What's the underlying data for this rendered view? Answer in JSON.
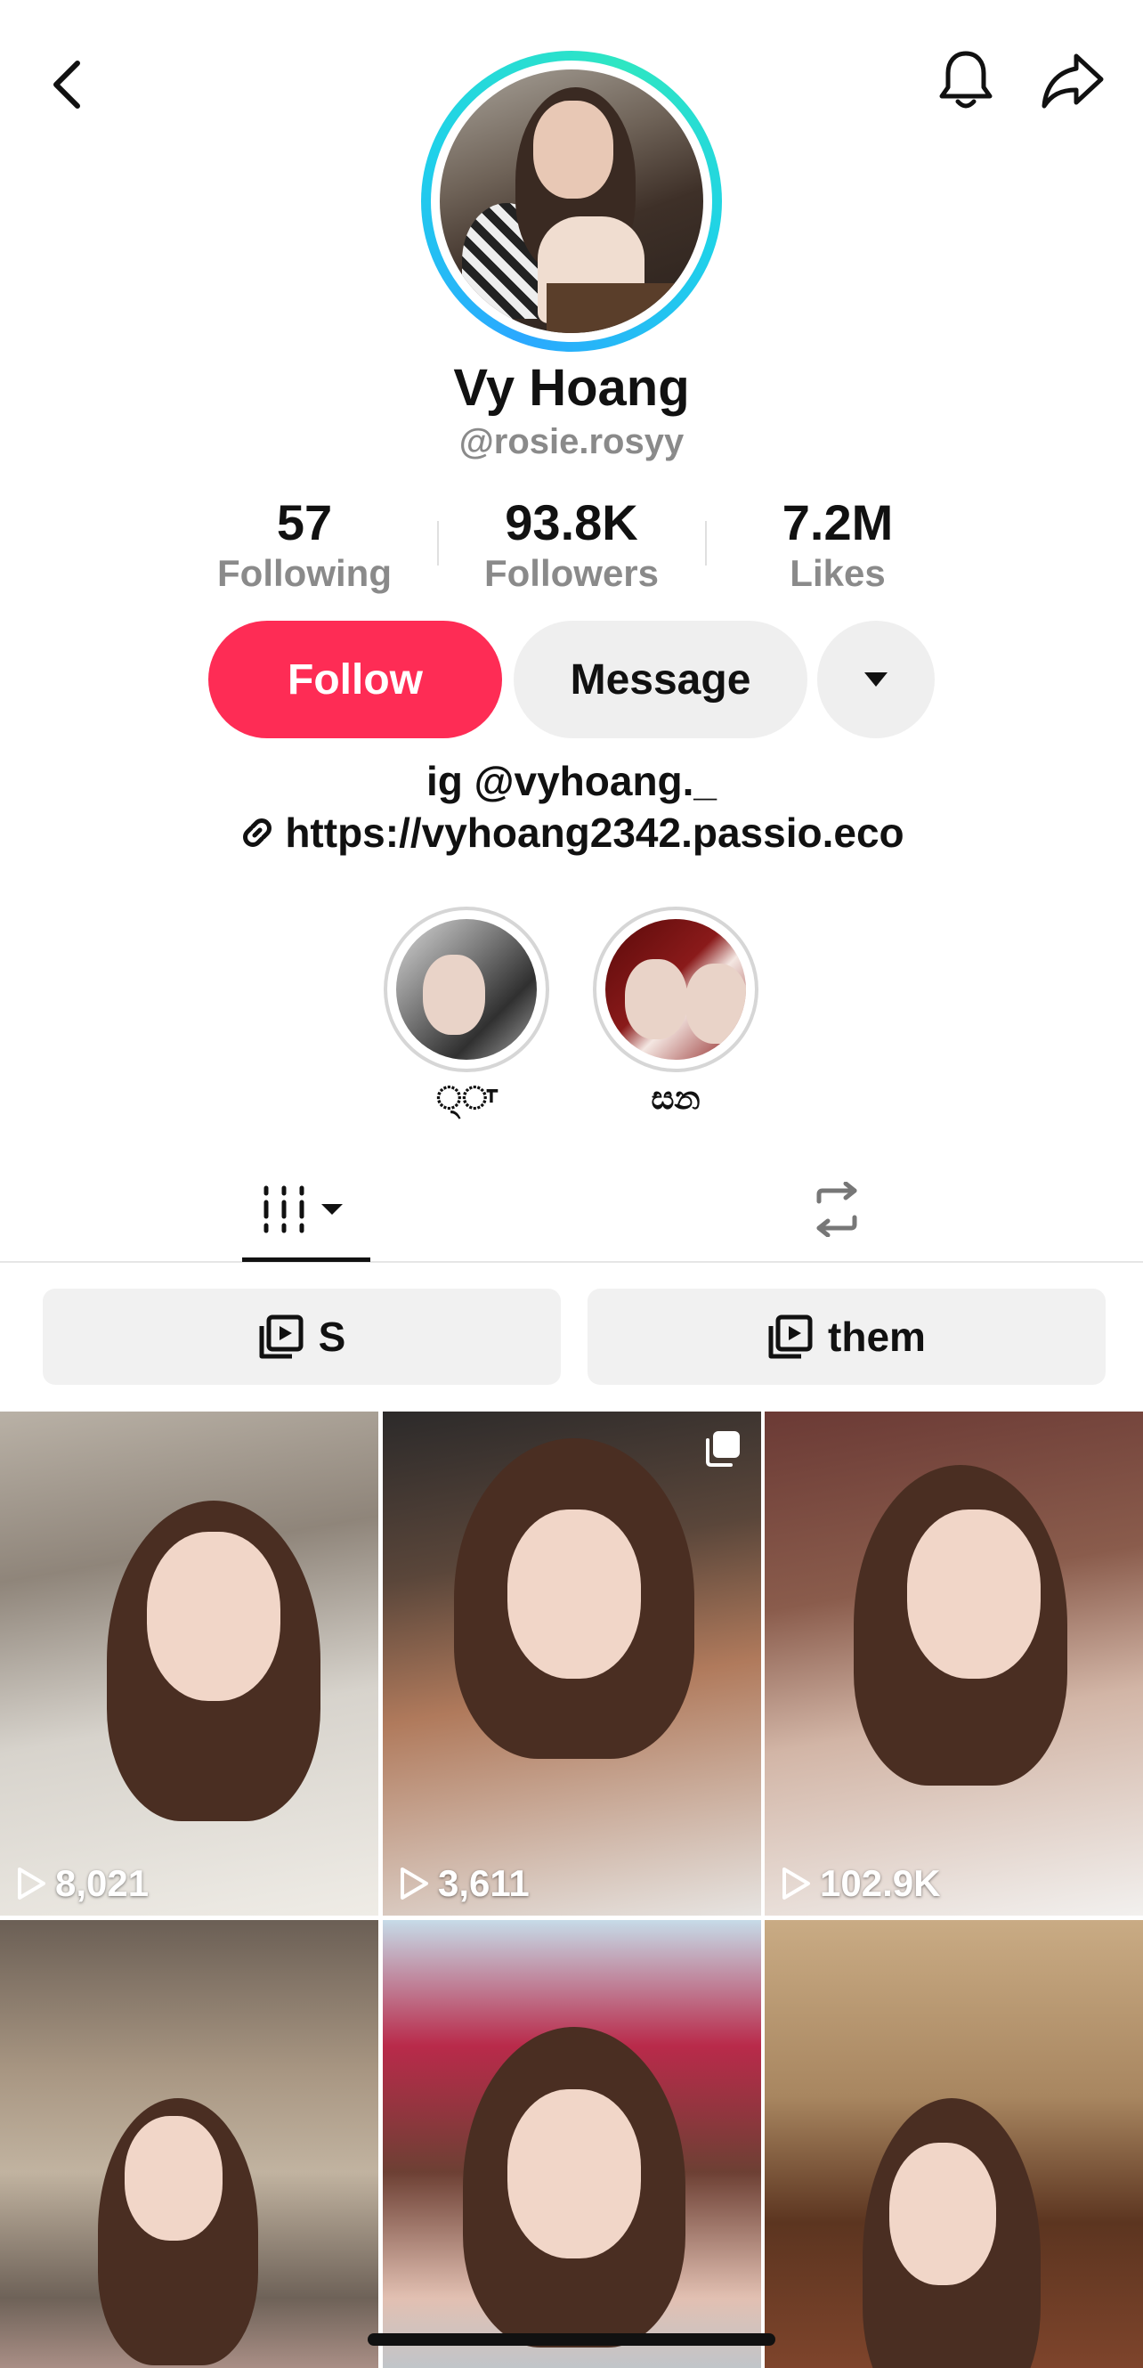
{
  "profile": {
    "name": "Vy Hoang",
    "handle": "@rosie.rosyy",
    "bio": "ig @vyhoang._",
    "link": "https://vyhoang2342.passio.eco"
  },
  "stats": [
    {
      "value": "57",
      "label": "Following"
    },
    {
      "value": "93.8K",
      "label": "Followers"
    },
    {
      "value": "7.2M",
      "label": "Likes"
    }
  ],
  "actions": {
    "follow_label": "Follow",
    "message_label": "Message"
  },
  "highlights": [
    {
      "label": "੍ਾ"
    },
    {
      "label": "සන"
    }
  ],
  "playlists": [
    {
      "label": "S"
    },
    {
      "label": "them"
    }
  ],
  "videos": [
    {
      "views": "8,021"
    },
    {
      "views": "3,611"
    },
    {
      "views": "102.9K"
    },
    {
      "views": ""
    },
    {
      "views": ""
    },
    {
      "views": ""
    }
  ],
  "colors": {
    "accent": "#fe2c55",
    "avatar_ring": "#1fd1e9",
    "secondary_bg": "#efefef",
    "muted_text": "#8a8a8a"
  },
  "icons": [
    "back-arrow-icon",
    "bell-icon",
    "share-icon",
    "dropdown-icon",
    "link-icon",
    "videos-grid-icon",
    "repost-icon",
    "playlist-icon",
    "play-icon",
    "multi-photo-icon"
  ]
}
